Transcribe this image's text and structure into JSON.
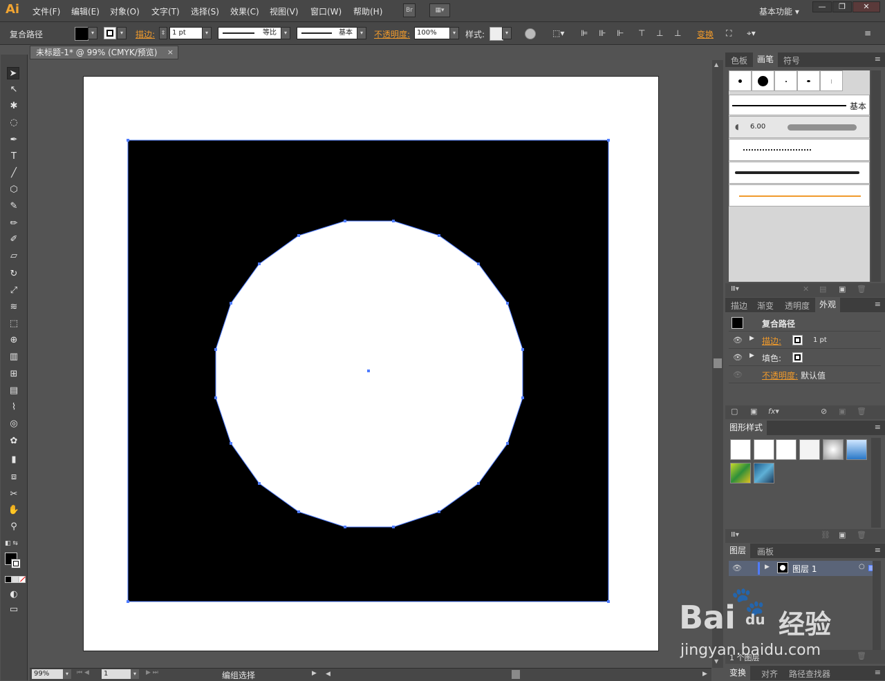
{
  "app": {
    "logo": "Ai"
  },
  "menu": {
    "items": [
      "文件(F)",
      "编辑(E)",
      "对象(O)",
      "文字(T)",
      "选择(S)",
      "效果(C)",
      "视图(V)",
      "窗口(W)",
      "帮助(H)"
    ],
    "bridge_label": "Br",
    "workspace": "基本功能 ▾",
    "win_min": "—",
    "win_restore": "❐",
    "win_close": "✕"
  },
  "control": {
    "selection_type": "复合路径",
    "stroke_label": "描边:",
    "stroke_weight": "1 pt",
    "profile": "等比",
    "brush": "基本",
    "opacity_label": "不透明度:",
    "opacity": "100%",
    "style_label": "样式:",
    "transform": "变换"
  },
  "document": {
    "tab_title": "未标题-1* @ 99% (CMYK/预览)",
    "close": "×"
  },
  "status": {
    "zoom": "99%",
    "artboard": "1",
    "mode": "编组选择"
  },
  "panels": {
    "brush_tabs": [
      "色板",
      "画笔",
      "符号"
    ],
    "brush_basic": "基本",
    "brush_size": "6.00",
    "appearance_tabs": [
      "描边",
      "渐变",
      "透明度",
      "外观"
    ],
    "appearance": {
      "title": "复合路径",
      "stroke_label": "描边:",
      "stroke_value": "1 pt",
      "fill_label": "填色:",
      "opacity_label": "不透明度:",
      "opacity_value": "默认值"
    },
    "graphic_styles_tab": "图形样式",
    "layers_tabs": [
      "图层",
      "画板"
    ],
    "layer_name": "图层 1",
    "layers_count": "1 个图层",
    "bottom_tabs": [
      "变换",
      "对齐",
      "路径查找器"
    ]
  },
  "watermark": {
    "brand": "Bai",
    "brand2": "经验",
    "du": "du",
    "url": "jingyan.baidu.com"
  },
  "colors": {
    "accent_orange": "#f09a2b",
    "selection_blue": "#4f7cff",
    "ui_dark": "#474747"
  }
}
